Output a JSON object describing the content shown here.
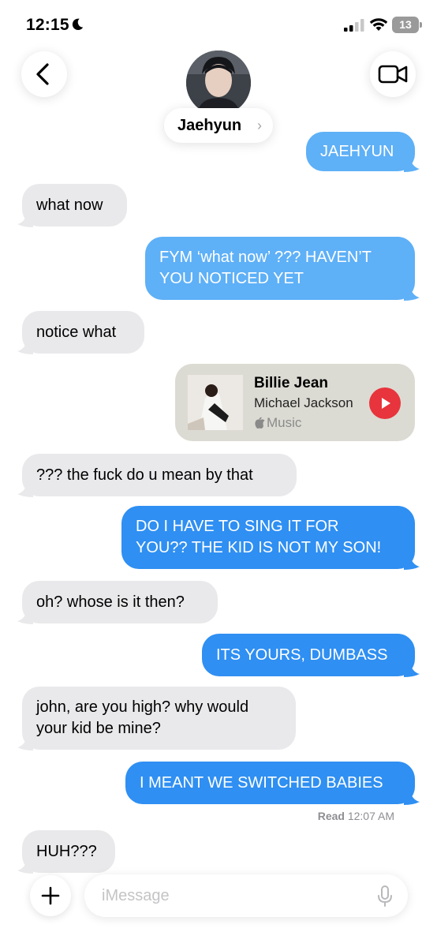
{
  "status_bar": {
    "time": "12:15",
    "battery": "13"
  },
  "header": {
    "contact_name": "Jaehyun",
    "chevron": "›"
  },
  "messages": [
    {
      "from": "me",
      "text": "JAEHYUN"
    },
    {
      "from": "them",
      "text": "what now"
    },
    {
      "from": "me",
      "lines": [
        "FYM ‘what now’ ??? HAVEN’T",
        "YOU NOTICED YET"
      ]
    },
    {
      "from": "them",
      "text": "notice what"
    },
    {
      "from": "me",
      "type": "music",
      "song": "Billie Jean",
      "artist": "Michael Jackson",
      "service": "Music"
    },
    {
      "from": "them",
      "text": "??? the fuck do u mean by that"
    },
    {
      "from": "me",
      "lines": [
        "DO I HAVE TO SING IT FOR",
        "YOU?? THE KID IS NOT MY SON!"
      ]
    },
    {
      "from": "them",
      "text": "oh? whose is it then?"
    },
    {
      "from": "me",
      "text": "ITS YOURS, DUMBASS"
    },
    {
      "from": "them",
      "lines": [
        "john, are you high? why would",
        "your kid be mine?"
      ]
    },
    {
      "from": "me",
      "text": "I MEANT WE SWITCHED BABIES"
    },
    {
      "from": "them",
      "text": "HUH???"
    }
  ],
  "receipt": {
    "label": "Read",
    "time": "12:07 AM"
  },
  "composer": {
    "placeholder": "iMessage"
  },
  "colors": {
    "outgoing": "#2f8ff2",
    "incoming": "#e9e9eb",
    "play": "#e8343c"
  },
  "icons": [
    "moon-icon",
    "signal-icon",
    "wifi-icon",
    "battery-icon",
    "back-chevron-icon",
    "video-camera-icon",
    "play-icon",
    "apple-logo-icon",
    "plus-icon",
    "microphone-icon"
  ]
}
